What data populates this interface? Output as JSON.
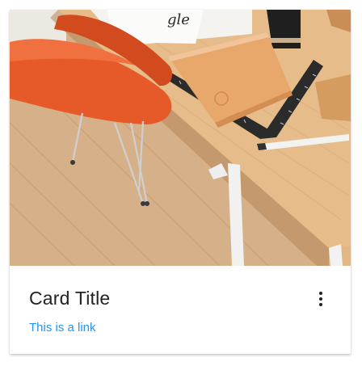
{
  "card": {
    "title": "Card Title",
    "link_text": "This is a link",
    "image_description_icon": "photo-image",
    "menu_icon": "more-vert-icon"
  },
  "colors": {
    "link": "#2196f3",
    "title": "#222222",
    "card_bg": "#ffffff"
  }
}
